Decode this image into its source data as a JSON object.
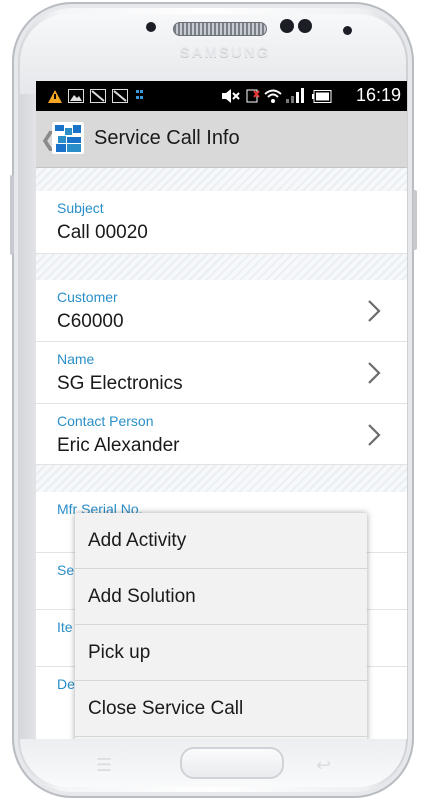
{
  "device": {
    "brand": "SAMSUNG"
  },
  "status_bar": {
    "time": "16:19",
    "icons": [
      "warning-icon",
      "image-icon",
      "no-signal-icon",
      "no-signal-icon",
      "dots-icon",
      "mute-icon",
      "no-sim-icon",
      "wifi-icon",
      "signal-icon",
      "battery-icon"
    ]
  },
  "action_bar": {
    "title": "Service Call Info",
    "app_icon": "sap-app-icon"
  },
  "fields": [
    {
      "label": "Subject",
      "value": "Call 00020",
      "has_chevron": false
    },
    {
      "label": "Customer",
      "value": "C60000",
      "has_chevron": true
    },
    {
      "label": "Name",
      "value": "SG Electronics",
      "has_chevron": true
    },
    {
      "label": "Contact Person",
      "value": "Eric Alexander",
      "has_chevron": true
    },
    {
      "label": "Mfr Serial No.",
      "value": "",
      "has_chevron": false
    },
    {
      "label": "Ser",
      "value": "",
      "has_chevron": false
    },
    {
      "label": "Ite",
      "value": "",
      "has_chevron": false
    },
    {
      "label": "Des",
      "value": "",
      "has_chevron": false
    }
  ],
  "context_menu": {
    "items": [
      "Add Activity",
      "Add Solution",
      "Pick up",
      "Close Service Call"
    ]
  },
  "colors": {
    "label_blue": "#2a8fc9",
    "action_bar": "#d9d9d9",
    "menu_bg": "#f2f2f2"
  }
}
